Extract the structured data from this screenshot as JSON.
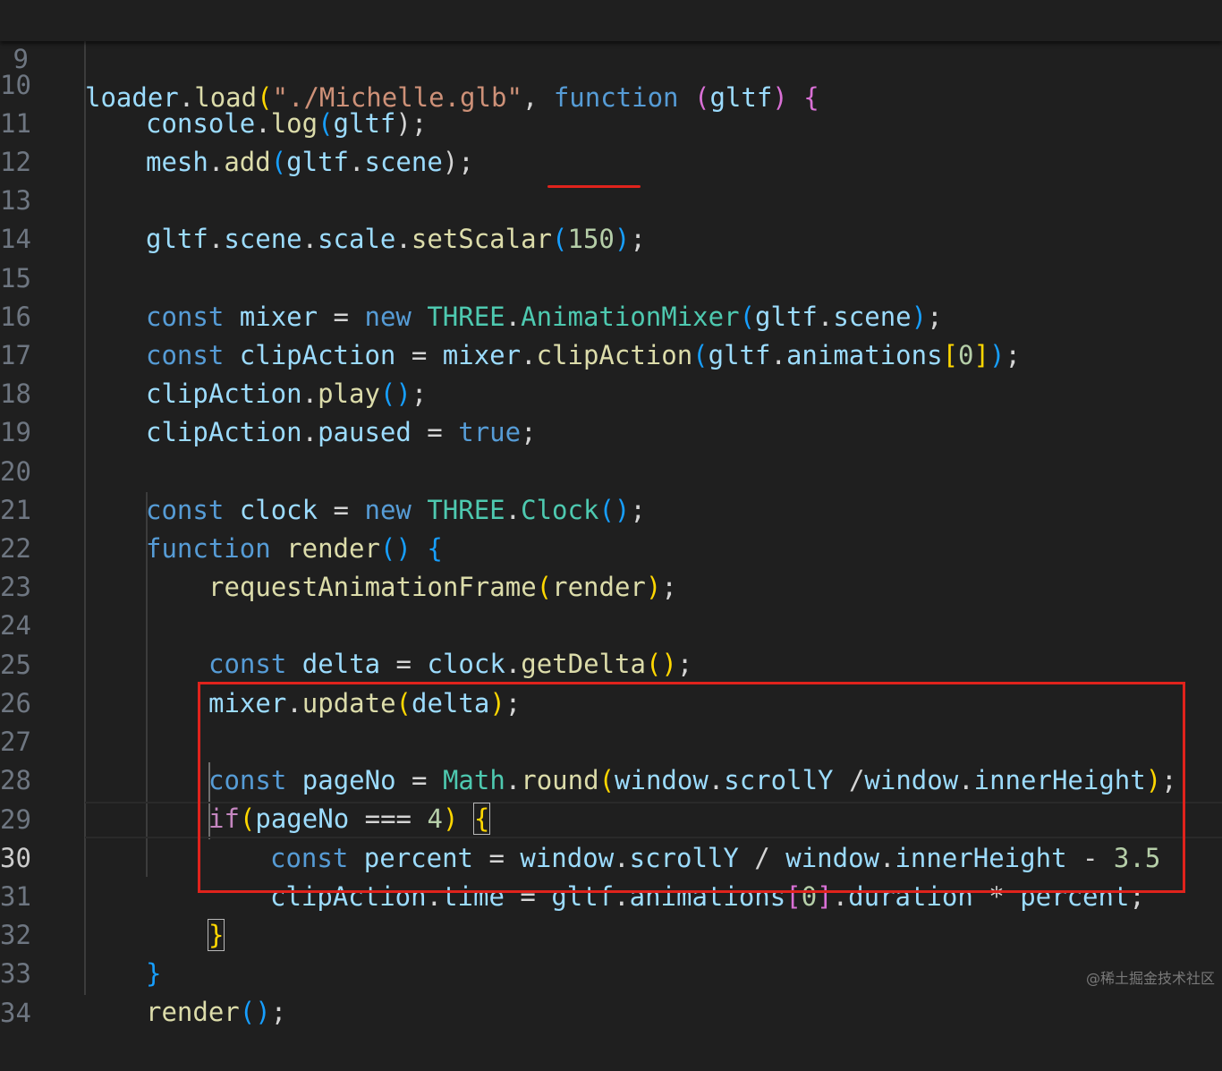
{
  "editor": {
    "sticky_line": {
      "number": "9",
      "tokens": [
        "loader",
        ".",
        "load",
        "(",
        "\"./Michelle.glb\"",
        ", ",
        "function",
        " (",
        "gltf",
        ") ",
        "{"
      ]
    },
    "lines": [
      {
        "number": "10",
        "tokens": [
          "console",
          ".",
          "log",
          "(",
          "gltf",
          ");"
        ]
      },
      {
        "number": "11",
        "tokens": [
          "mesh",
          ".",
          "add",
          "(",
          "gltf",
          ".",
          "scene",
          ");"
        ]
      },
      {
        "number": "12",
        "tokens": []
      },
      {
        "number": "13",
        "tokens": [
          "gltf",
          ".",
          "scene",
          ".",
          "scale",
          ".",
          "setScalar",
          "(",
          "150",
          ")",
          ";"
        ]
      },
      {
        "number": "14",
        "tokens": []
      },
      {
        "number": "15",
        "tokens": [
          "const",
          " ",
          "mixer",
          " = ",
          "new",
          " ",
          "THREE",
          ".",
          "AnimationMixer",
          "(",
          "gltf",
          ".",
          "scene",
          ")",
          ";"
        ]
      },
      {
        "number": "16",
        "tokens": [
          "const",
          " ",
          "clipAction",
          " = ",
          "mixer",
          ".",
          "clipAction",
          "(",
          "gltf",
          ".",
          "animations",
          "[",
          "0",
          "]",
          ")",
          ";"
        ]
      },
      {
        "number": "17",
        "tokens": [
          "clipAction",
          ".",
          "play",
          "()",
          ";"
        ]
      },
      {
        "number": "18",
        "tokens": [
          "clipAction",
          ".",
          "paused",
          " = ",
          "true",
          ";"
        ]
      },
      {
        "number": "19",
        "tokens": []
      },
      {
        "number": "20",
        "tokens": [
          "const",
          " ",
          "clock",
          " = ",
          "new",
          " ",
          "THREE",
          ".",
          "Clock",
          "()",
          ";"
        ]
      },
      {
        "number": "21",
        "tokens": [
          "function",
          " ",
          "render",
          "()",
          " ",
          "{"
        ]
      },
      {
        "number": "22",
        "tokens": [
          "requestAnimationFrame",
          "(",
          "render",
          ")",
          ";"
        ]
      },
      {
        "number": "23",
        "tokens": []
      },
      {
        "number": "24",
        "tokens": [
          "const",
          " ",
          "delta",
          " = ",
          "clock",
          ".",
          "getDelta",
          "()",
          ";"
        ]
      },
      {
        "number": "25",
        "tokens": [
          "mixer",
          ".",
          "update",
          "(",
          "delta",
          ")",
          ";"
        ]
      },
      {
        "number": "26",
        "tokens": []
      },
      {
        "number": "27",
        "tokens": [
          "const",
          " ",
          "pageNo",
          " = ",
          "Math",
          ".",
          "round",
          "(",
          "window",
          ".",
          "scrollY",
          " /",
          "window",
          ".",
          "innerHeight",
          ")",
          ";"
        ]
      },
      {
        "number": "28",
        "tokens": [
          "if",
          "(",
          "pageNo",
          " === ",
          "4",
          ") ",
          "{"
        ]
      },
      {
        "number": "29",
        "tokens": [
          "const",
          " ",
          "percent",
          " = ",
          "window",
          ".",
          "scrollY",
          " / ",
          "window",
          ".",
          "innerHeight",
          " - ",
          "3.5"
        ]
      },
      {
        "number": "30",
        "tokens": [
          "clipAction",
          ".",
          "time",
          " = ",
          "gltf",
          ".",
          "animations",
          "[",
          "0",
          "]",
          ".",
          "duration",
          " * ",
          "percent",
          ";"
        ]
      },
      {
        "number": "31",
        "tokens": [
          "}"
        ]
      },
      {
        "number": "32",
        "tokens": [
          "}"
        ]
      },
      {
        "number": "33",
        "tokens": [
          "render",
          "()",
          ";"
        ]
      },
      {
        "number": "34",
        "tokens": []
      }
    ]
  },
  "watermark": "@稀土掘金技术社区",
  "colors": {
    "background": "#1f1f1f",
    "annotation_red": "#e0231c",
    "variable": "#9cdcfe",
    "function": "#dcdcaa",
    "keyword": "#569cd6",
    "class": "#4ec9b0",
    "string": "#ce9178",
    "number": "#b5cea8"
  }
}
